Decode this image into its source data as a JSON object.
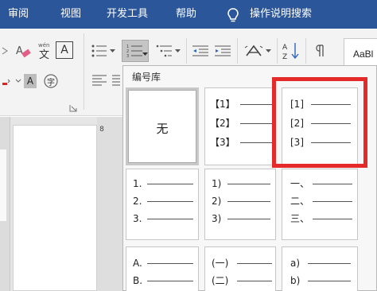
{
  "menu": {
    "items": [
      {
        "label": "审阅"
      },
      {
        "label": "视图"
      },
      {
        "label": "开发工具"
      },
      {
        "label": "帮助"
      },
      {
        "label": "操作说明搜索"
      }
    ]
  },
  "ribbon": {
    "styles_preview": "AaBl",
    "ruler_mark": "8",
    "buttons": {
      "phonetic": "wén",
      "char_border": "A",
      "char_shading": "A",
      "enclose": "字"
    }
  },
  "numbering_library": {
    "title": "编号库",
    "none_label": "无",
    "cells": [
      {
        "markers": []
      },
      {
        "markers": [
          "【1】",
          "【2】",
          "【3】"
        ]
      },
      {
        "markers": [
          "[1]",
          "[2]",
          "[3]"
        ]
      },
      {
        "markers": [
          "1.",
          "2.",
          "3."
        ]
      },
      {
        "markers": [
          "1)",
          "2)",
          "3)"
        ]
      },
      {
        "markers": [
          "一、",
          "二、",
          "三、"
        ]
      },
      {
        "markers": [
          "A.",
          "B."
        ]
      },
      {
        "markers": [
          "(一)",
          "(二)"
        ]
      },
      {
        "markers": [
          "a)",
          "b)"
        ]
      }
    ]
  },
  "colors": {
    "title_bar": "#2b579a",
    "highlight": "#e52a2a"
  }
}
